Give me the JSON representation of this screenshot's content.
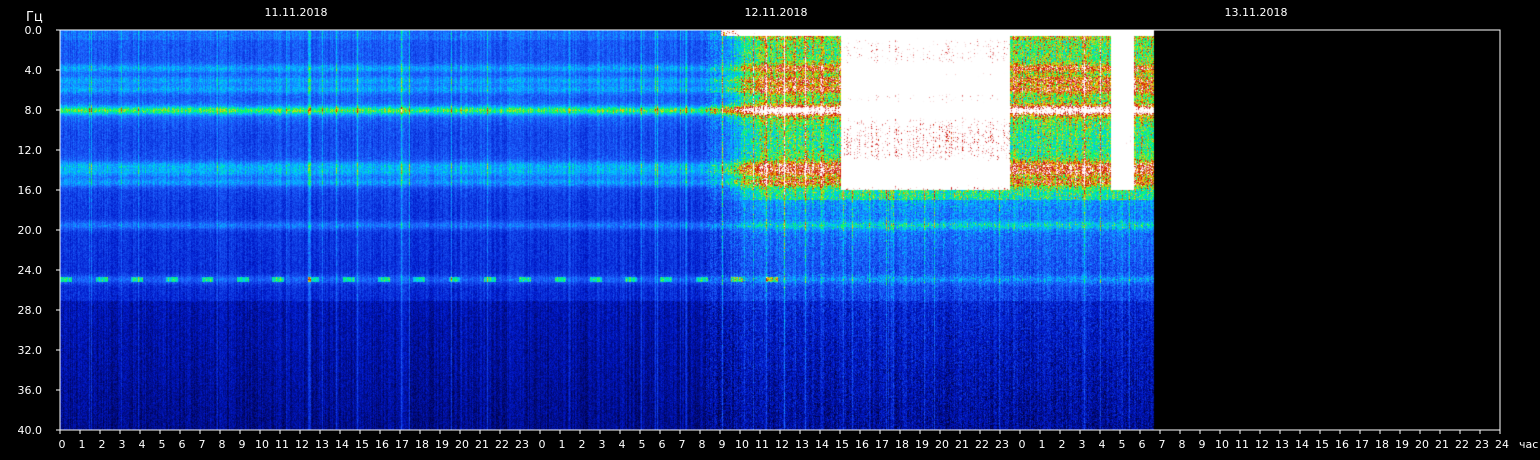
{
  "chart_data": {
    "type": "heatmap",
    "title": "",
    "ylabel": "Гц",
    "xlabel": "час",
    "ylim": [
      0,
      40
    ],
    "y_ticks": [
      "0.0",
      "4.0",
      "8.0",
      "12.0",
      "16.0",
      "20.0",
      "24.0",
      "28.0",
      "32.0",
      "36.0",
      "40.0"
    ],
    "x_tick_labels": [
      "0",
      "1",
      "2",
      "3",
      "4",
      "5",
      "6",
      "7",
      "8",
      "9",
      "10",
      "11",
      "12",
      "13",
      "14",
      "15",
      "16",
      "17",
      "18",
      "19",
      "20",
      "21",
      "22",
      "23",
      "0",
      "1",
      "2",
      "3",
      "4",
      "5",
      "6",
      "7",
      "8",
      "9",
      "10",
      "11",
      "12",
      "13",
      "14",
      "15",
      "16",
      "17",
      "18",
      "19",
      "20",
      "21",
      "22",
      "23",
      "0",
      "1",
      "2",
      "3",
      "4",
      "5",
      "6",
      "7",
      "8",
      "9",
      "10",
      "11",
      "12",
      "13",
      "14",
      "15",
      "16",
      "17",
      "18",
      "19",
      "20",
      "21",
      "22",
      "23",
      "24"
    ],
    "date_labels": [
      "11.11.2018",
      "12.11.2018",
      "13.11.2018"
    ],
    "data_end_hour": 54.7,
    "colormap": [
      "#00003c",
      "#0018c8",
      "#1e64ff",
      "#00c8ff",
      "#00ff64",
      "#ffd200",
      "#c80000",
      "#ffffff"
    ],
    "bands_hz": [
      3.8,
      5.0,
      5.9,
      8.0,
      13.5,
      14.2,
      15.2,
      19.5,
      24.9
    ],
    "intense_regions": [
      {
        "start_hour": 32.2,
        "end_hour": 54.7,
        "fmax_hz": 17
      },
      {
        "start_hour": 39.0,
        "end_hour": 47.5,
        "fmax_hz": 16
      }
    ],
    "grid": false,
    "legend": "none"
  }
}
